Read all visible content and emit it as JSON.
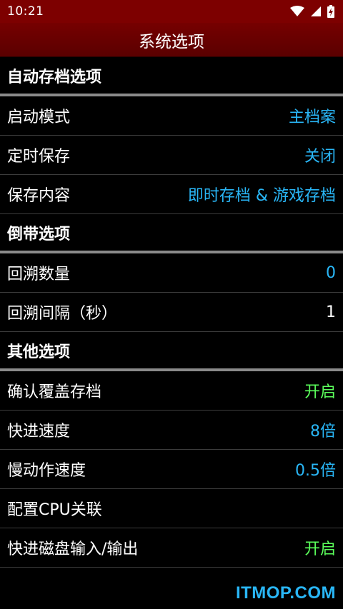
{
  "status": {
    "time": "10:21",
    "icons": [
      "wifi-icon",
      "signal-icon",
      "battery-charging-icon"
    ]
  },
  "header": {
    "title": "系统选项"
  },
  "colors": {
    "accent_blue": "#29b6f6",
    "accent_green": "#5bff5b",
    "bar_red": "#7d0000"
  },
  "sections": {
    "autosave": {
      "title": "自动存档选项",
      "items": [
        {
          "label": "启动模式",
          "value": "主档案"
        },
        {
          "label": "定时保存",
          "value": "关闭"
        },
        {
          "label": "保存内容",
          "value": "即时存档 & 游戏存档"
        }
      ]
    },
    "rewind": {
      "title": "倒带选项",
      "items": [
        {
          "label": "回溯数量",
          "value": "0"
        },
        {
          "label": "回溯间隔（秒）",
          "value": "1"
        }
      ]
    },
    "other": {
      "title": "其他选项",
      "items": [
        {
          "label": "确认覆盖存档",
          "value": "开启"
        },
        {
          "label": "快进速度",
          "value": "8倍"
        },
        {
          "label": "慢动作速度",
          "value": "0.5倍"
        },
        {
          "label": "配置CPU关联",
          "value": ""
        },
        {
          "label": "快进磁盘输入/输出",
          "value": "开启"
        }
      ]
    }
  },
  "watermark": "ITMOP.COM"
}
